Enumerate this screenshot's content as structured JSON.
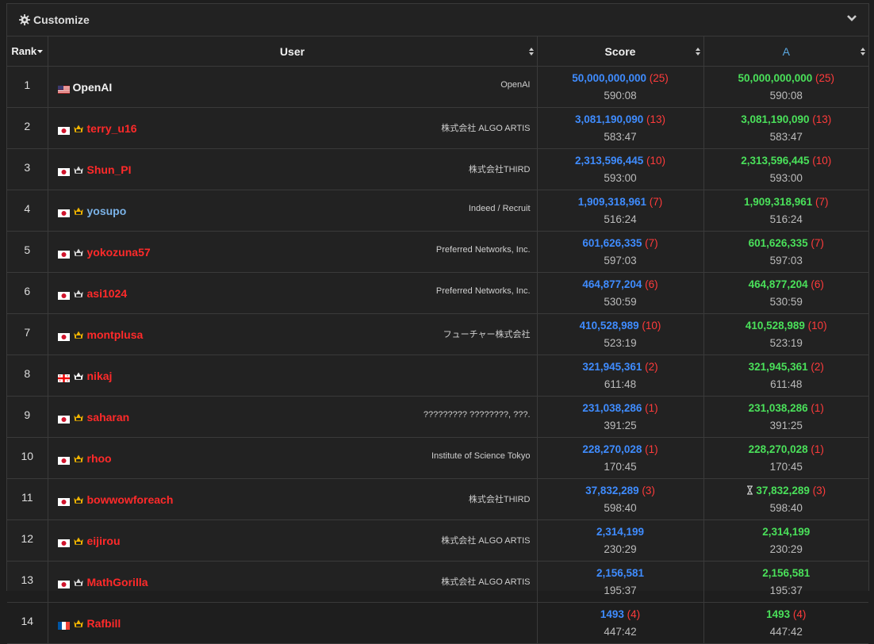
{
  "customize": {
    "label": "Customize"
  },
  "headers": {
    "rank": "Rank",
    "user": "User",
    "score": "Score",
    "a": "A"
  },
  "colors": {
    "score_blue": "#3f8cff",
    "a_green": "#4ae05a",
    "penalty_red": "#ff3b3b",
    "user_red": "#ff2a2a",
    "user_blue": "#7bb3e8",
    "user_white": "#f2f2f2"
  },
  "rows": [
    {
      "rank": "1",
      "flag": "us-flag",
      "crown": "",
      "name": "OpenAI",
      "name_color": "white",
      "aff": "OpenAI",
      "score": "50,000,000,000",
      "pen": "(25)",
      "time": "590:08",
      "a_score": "50,000,000,000",
      "a_pen": "(25)",
      "a_time": "590:08",
      "pending": false
    },
    {
      "rank": "2",
      "flag": "jp-flag",
      "crown": "gold-crown-icon",
      "name": "terry_u16",
      "name_color": "red",
      "aff": "株式会社 ALGO ARTIS",
      "score": "3,081,190,090",
      "pen": "(13)",
      "time": "583:47",
      "a_score": "3,081,190,090",
      "a_pen": "(13)",
      "a_time": "583:47",
      "pending": false
    },
    {
      "rank": "3",
      "flag": "jp-flag",
      "crown": "silver-crown-icon",
      "name": "Shun_PI",
      "name_color": "red",
      "aff": "株式会社THIRD",
      "score": "2,313,596,445",
      "pen": "(10)",
      "time": "593:00",
      "a_score": "2,313,596,445",
      "a_pen": "(10)",
      "a_time": "593:00",
      "pending": false
    },
    {
      "rank": "4",
      "flag": "jp-flag",
      "crown": "gold-crown-icon",
      "name": "yosupo",
      "name_color": "blue",
      "aff": "Indeed / Recruit",
      "score": "1,909,318,961",
      "pen": "(7)",
      "time": "516:24",
      "a_score": "1,909,318,961",
      "a_pen": "(7)",
      "a_time": "516:24",
      "pending": false
    },
    {
      "rank": "5",
      "flag": "jp-flag",
      "crown": "silver-crown-icon",
      "name": "yokozuna57",
      "name_color": "red",
      "aff": "Preferred Networks, Inc.",
      "score": "601,626,335",
      "pen": "(7)",
      "time": "597:03",
      "a_score": "601,626,335",
      "a_pen": "(7)",
      "a_time": "597:03",
      "pending": false
    },
    {
      "rank": "6",
      "flag": "jp-flag",
      "crown": "silver-crown-icon",
      "name": "asi1024",
      "name_color": "red",
      "aff": "Preferred Networks, Inc.",
      "score": "464,877,204",
      "pen": "(6)",
      "time": "530:59",
      "a_score": "464,877,204",
      "a_pen": "(6)",
      "a_time": "530:59",
      "pending": false
    },
    {
      "rank": "7",
      "flag": "jp-flag",
      "crown": "gold-crown-icon",
      "name": "montplusa",
      "name_color": "red",
      "aff": "フューチャー株式会社",
      "score": "410,528,989",
      "pen": "(10)",
      "time": "523:19",
      "a_score": "410,528,989",
      "a_pen": "(10)",
      "a_time": "523:19",
      "pending": false
    },
    {
      "rank": "8",
      "flag": "ge-flag",
      "crown": "white-crown-icon",
      "name": "nikaj",
      "name_color": "red",
      "aff": "",
      "score": "321,945,361",
      "pen": "(2)",
      "time": "611:48",
      "a_score": "321,945,361",
      "a_pen": "(2)",
      "a_time": "611:48",
      "pending": false
    },
    {
      "rank": "9",
      "flag": "jp-flag",
      "crown": "gold-crown-icon",
      "name": "saharan",
      "name_color": "red",
      "aff": "????????? ????????, ???.",
      "score": "231,038,286",
      "pen": "(1)",
      "time": "391:25",
      "a_score": "231,038,286",
      "a_pen": "(1)",
      "a_time": "391:25",
      "pending": false
    },
    {
      "rank": "10",
      "flag": "jp-flag",
      "crown": "gold-crown-icon",
      "name": "rhoo",
      "name_color": "red",
      "aff": "Institute of Science Tokyo",
      "score": "228,270,028",
      "pen": "(1)",
      "time": "170:45",
      "a_score": "228,270,028",
      "a_pen": "(1)",
      "a_time": "170:45",
      "pending": false
    },
    {
      "rank": "11",
      "flag": "jp-flag",
      "crown": "gold-crown-icon",
      "name": "bowwowforeach",
      "name_color": "red",
      "aff": "株式会社THIRD",
      "score": "37,832,289",
      "pen": "(3)",
      "time": "598:40",
      "a_score": "37,832,289",
      "a_pen": "(3)",
      "a_time": "598:40",
      "pending": true
    },
    {
      "rank": "12",
      "flag": "jp-flag",
      "crown": "gold-crown-icon",
      "name": "eijirou",
      "name_color": "red",
      "aff": "株式会社 ALGO ARTIS",
      "score": "2,314,199",
      "pen": "",
      "time": "230:29",
      "a_score": "2,314,199",
      "a_pen": "",
      "a_time": "230:29",
      "pending": false
    },
    {
      "rank": "13",
      "flag": "jp-flag",
      "crown": "silver-crown-icon",
      "name": "MathGorilla",
      "name_color": "red",
      "aff": "株式会社 ALGO ARTIS",
      "score": "2,156,581",
      "pen": "",
      "time": "195:37",
      "a_score": "2,156,581",
      "a_pen": "",
      "a_time": "195:37",
      "pending": false
    },
    {
      "rank": "14",
      "flag": "fr-flag",
      "crown": "gold-crown-icon",
      "name": "Rafbill",
      "name_color": "red",
      "aff": "",
      "score": "1493",
      "pen": "(4)",
      "time": "447:42",
      "a_score": "1493",
      "a_pen": "(4)",
      "a_time": "447:42",
      "pending": false
    }
  ]
}
